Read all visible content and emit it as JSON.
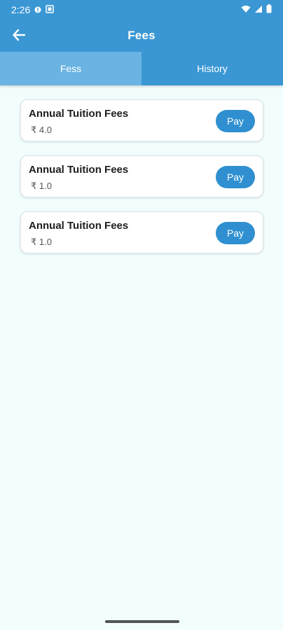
{
  "status_bar": {
    "time": "2:26",
    "icons": [
      "notification-dot-icon",
      "screenshot-icon",
      "wifi-icon",
      "signal-icon",
      "battery-icon"
    ]
  },
  "app_bar": {
    "title": "Fees",
    "back_icon": "arrow-left-icon"
  },
  "tabs": [
    {
      "label": "Fess",
      "active": true
    },
    {
      "label": "History",
      "active": false
    }
  ],
  "fees": [
    {
      "title": "Annual Tuition Fees",
      "amount": "₹ 4.0",
      "button_label": "Pay"
    },
    {
      "title": "Annual Tuition Fees",
      "amount": "₹ 1.0",
      "button_label": "Pay"
    },
    {
      "title": "Annual Tuition Fees",
      "amount": "₹ 1.0",
      "button_label": "Pay"
    }
  ],
  "colors": {
    "primary": "#3a97d4",
    "active_tab": "#6ab3e2",
    "pay_button": "#2f8fd0",
    "background": "#f2fdfe"
  }
}
